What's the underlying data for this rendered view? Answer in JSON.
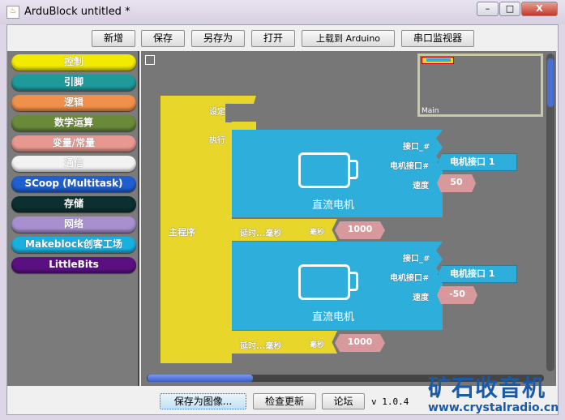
{
  "window": {
    "title": "ArduBlock untitled *",
    "minimize": "–",
    "maximize": "□",
    "close": "X"
  },
  "toolbar": [
    "新增",
    "保存",
    "另存为",
    "打开",
    "上载到 Arduino",
    "串口监视器"
  ],
  "palette": [
    {
      "label": "控制",
      "color": "#f2ea00"
    },
    {
      "label": "引脚",
      "color": "#1f9a9a"
    },
    {
      "label": "逻辑",
      "color": "#f0904a"
    },
    {
      "label": "数学运算",
      "color": "#6a8a3a"
    },
    {
      "label": "变量/常量",
      "color": "#e89890"
    },
    {
      "label": "通信",
      "color": "#f2f2f2"
    },
    {
      "label": "SCoop (Multitask)",
      "color": "#1f5fd0"
    },
    {
      "label": "存储",
      "color": "#0c3030"
    },
    {
      "label": "网络",
      "color": "#a890d0"
    },
    {
      "label": "Makeblock创客工场",
      "color": "#18b0e0"
    },
    {
      "label": "LittleBits",
      "color": "#5a1080"
    }
  ],
  "minimap": {
    "label": "Main"
  },
  "program": {
    "main_label": "主程序",
    "setup_label": "设定",
    "loop_label": "执行",
    "blocks": [
      {
        "title": "直流电机",
        "port_label": "接口_#",
        "motor_port_label": "电机接口#",
        "motor_port_value": "电机接口 1",
        "speed_label": "速度",
        "speed_value": "50"
      },
      {
        "delay_label": "延时...毫秒",
        "ms_label": "毫秒",
        "value": "1000"
      },
      {
        "title": "直流电机",
        "port_label": "接口_#",
        "motor_port_label": "电机接口#",
        "motor_port_value": "电机接口 1",
        "speed_label": "速度",
        "speed_value": "-50"
      },
      {
        "delay_label": "延时...毫秒",
        "ms_label": "毫秒",
        "value": "1000"
      }
    ]
  },
  "bottom": {
    "save_image": "保存为图像...",
    "check_update": "检查更新",
    "forum": "论坛",
    "version": "v 1.0.4"
  },
  "watermark": {
    "line1": "矿石收音机",
    "line2": "www.crystalradio.cn"
  }
}
